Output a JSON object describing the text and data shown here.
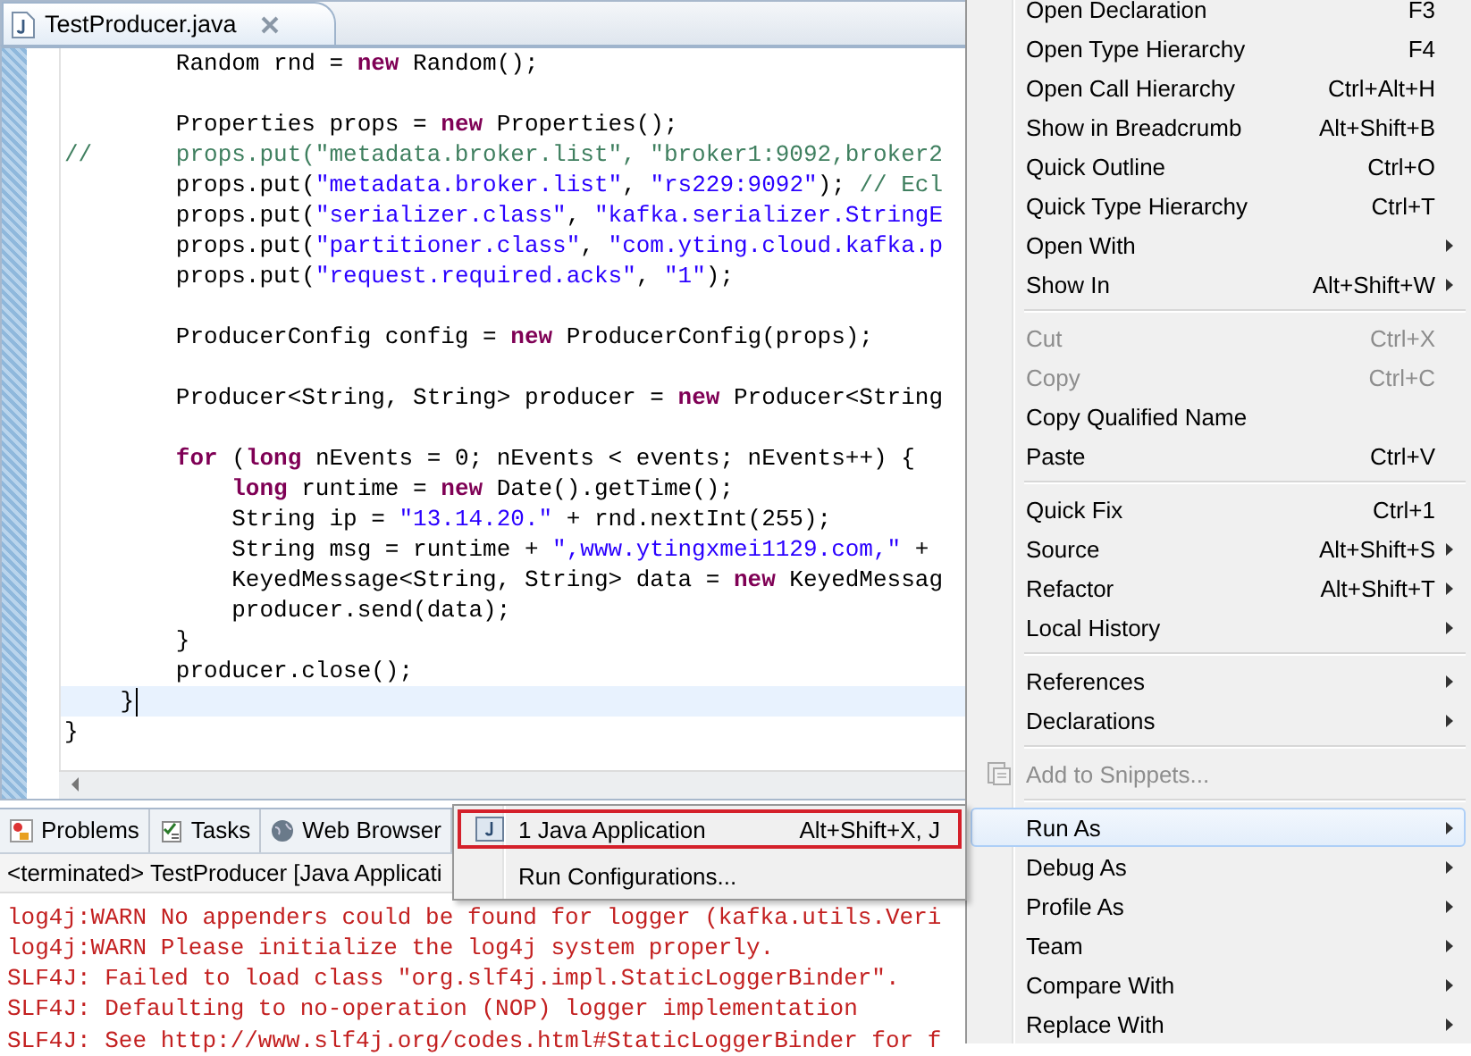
{
  "editor": {
    "tab": {
      "title": "TestProducer.java",
      "selected": true
    },
    "lines": [
      {
        "current": false,
        "tokens": [
          {
            "kind": "plain",
            "text": "        Random rnd = "
          },
          {
            "kind": "keyword",
            "text": "new"
          },
          {
            "kind": "plain",
            "text": " Random();"
          }
        ]
      },
      {
        "current": false
      },
      {
        "current": false,
        "tokens": [
          {
            "kind": "plain",
            "text": "        Properties props = "
          },
          {
            "kind": "keyword",
            "text": "new"
          },
          {
            "kind": "plain",
            "text": " Properties();"
          }
        ]
      },
      {
        "current": false,
        "tokens": [
          {
            "kind": "comment",
            "text": "//      props.put(\"metadata.broker.list\", \"broker1:9092,broker2"
          }
        ]
      },
      {
        "current": false,
        "tokens": [
          {
            "kind": "plain",
            "text": "        props.put("
          },
          {
            "kind": "string",
            "text": "\"metadata.broker.list\""
          },
          {
            "kind": "plain",
            "text": ", "
          },
          {
            "kind": "string",
            "text": "\"rs229:9092\""
          },
          {
            "kind": "plain",
            "text": "); "
          },
          {
            "kind": "comment",
            "text": "// Ecl"
          }
        ]
      },
      {
        "current": false,
        "tokens": [
          {
            "kind": "plain",
            "text": "        props.put("
          },
          {
            "kind": "string",
            "text": "\"serializer.class\""
          },
          {
            "kind": "plain",
            "text": ", "
          },
          {
            "kind": "string",
            "text": "\"kafka.serializer.StringE"
          }
        ]
      },
      {
        "current": false,
        "tokens": [
          {
            "kind": "plain",
            "text": "        props.put("
          },
          {
            "kind": "string",
            "text": "\"partitioner.class\""
          },
          {
            "kind": "plain",
            "text": ", "
          },
          {
            "kind": "string",
            "text": "\"com.yting.cloud.kafka.p"
          }
        ]
      },
      {
        "current": false,
        "tokens": [
          {
            "kind": "plain",
            "text": "        props.put("
          },
          {
            "kind": "string",
            "text": "\"request.required.acks\""
          },
          {
            "kind": "plain",
            "text": ", "
          },
          {
            "kind": "string",
            "text": "\"1\""
          },
          {
            "kind": "plain",
            "text": ");"
          }
        ]
      },
      {
        "current": false
      },
      {
        "current": false,
        "tokens": [
          {
            "kind": "plain",
            "text": "        ProducerConfig config = "
          },
          {
            "kind": "keyword",
            "text": "new"
          },
          {
            "kind": "plain",
            "text": " ProducerConfig(props);"
          }
        ]
      },
      {
        "current": false
      },
      {
        "current": false,
        "tokens": [
          {
            "kind": "plain",
            "text": "        Producer<String, String> producer = "
          },
          {
            "kind": "keyword",
            "text": "new"
          },
          {
            "kind": "plain",
            "text": " Producer<String"
          }
        ]
      },
      {
        "current": false
      },
      {
        "current": false,
        "tokens": [
          {
            "kind": "keyword",
            "text": "        for"
          },
          {
            "kind": "plain",
            "text": " ("
          },
          {
            "kind": "keyword",
            "text": "long"
          },
          {
            "kind": "plain",
            "text": " nEvents = 0; nEvents < events; nEvents++) {"
          }
        ]
      },
      {
        "current": false,
        "tokens": [
          {
            "kind": "keyword",
            "text": "            long"
          },
          {
            "kind": "plain",
            "text": " runtime = "
          },
          {
            "kind": "keyword",
            "text": "new"
          },
          {
            "kind": "plain",
            "text": " Date().getTime();"
          }
        ]
      },
      {
        "current": false,
        "tokens": [
          {
            "kind": "plain",
            "text": "            String ip = "
          },
          {
            "kind": "string",
            "text": "\"13.14.20.\""
          },
          {
            "kind": "plain",
            "text": " + rnd.nextInt(255);"
          }
        ]
      },
      {
        "current": false,
        "tokens": [
          {
            "kind": "plain",
            "text": "            String msg = runtime + "
          },
          {
            "kind": "string",
            "text": "\",www.ytingxmei1129.com,\""
          },
          {
            "kind": "plain",
            "text": " +"
          }
        ]
      },
      {
        "current": false,
        "tokens": [
          {
            "kind": "plain",
            "text": "            KeyedMessage<String, String> data = "
          },
          {
            "kind": "keyword",
            "text": "new"
          },
          {
            "kind": "plain",
            "text": " KeyedMessag"
          }
        ]
      },
      {
        "current": false,
        "tokens": [
          {
            "kind": "plain",
            "text": "            producer.send(data);"
          }
        ]
      },
      {
        "current": false,
        "tokens": [
          {
            "kind": "plain",
            "text": "        }"
          }
        ]
      },
      {
        "current": false,
        "tokens": [
          {
            "kind": "plain",
            "text": "        producer.close();"
          }
        ]
      },
      {
        "current": true,
        "tokens": [
          {
            "kind": "plain",
            "text": "    }"
          }
        ]
      },
      {
        "current": false,
        "tokens": [
          {
            "kind": "plain",
            "text": "}"
          }
        ]
      }
    ]
  },
  "panel": {
    "tabs": [
      {
        "label": "Problems",
        "kind": "problems",
        "selected": false
      },
      {
        "label": "Tasks",
        "kind": "tasks",
        "selected": false
      },
      {
        "label": "Web Browser",
        "kind": "browser",
        "selected": false
      }
    ],
    "console_header": "<terminated> TestProducer [Java Applicati",
    "console_lines": [
      "log4j:WARN No appenders could be found for logger (kafka.utils.Veri",
      "log4j:WARN Please initialize the log4j system properly.",
      "SLF4J: Failed to load class \"org.slf4j.impl.StaticLoggerBinder\".",
      "SLF4J: Defaulting to no-operation (NOP) logger implementation",
      "SLF4J: See http://www.slf4j.org/codes.html#StaticLoggerBinder for f"
    ]
  },
  "context_menu": {
    "sections": [
      {
        "items": [
          {
            "label": "Open Declaration",
            "shortcut": "F3",
            "submenu": false,
            "disabled": false,
            "selected": false,
            "kind": "plain"
          },
          {
            "label": "Open Type Hierarchy",
            "shortcut": "F4",
            "submenu": false,
            "disabled": false,
            "selected": false,
            "kind": "plain"
          },
          {
            "label": "Open Call Hierarchy",
            "shortcut": "Ctrl+Alt+H",
            "submenu": false,
            "disabled": false,
            "selected": false,
            "kind": "plain"
          },
          {
            "label": "Show in Breadcrumb",
            "shortcut": "Alt+Shift+B",
            "submenu": false,
            "disabled": false,
            "selected": false,
            "kind": "plain"
          },
          {
            "label": "Quick Outline",
            "shortcut": "Ctrl+O",
            "submenu": false,
            "disabled": false,
            "selected": false,
            "kind": "plain"
          },
          {
            "label": "Quick Type Hierarchy",
            "shortcut": "Ctrl+T",
            "submenu": false,
            "disabled": false,
            "selected": false,
            "kind": "plain"
          },
          {
            "label": "Open With",
            "submenu": true,
            "disabled": false,
            "selected": false,
            "kind": "plain"
          },
          {
            "label": "Show In",
            "shortcut": "Alt+Shift+W",
            "submenu": true,
            "disabled": false,
            "selected": false,
            "kind": "plain"
          }
        ]
      },
      {
        "items": [
          {
            "label": "Cut",
            "shortcut": "Ctrl+X",
            "submenu": false,
            "disabled": true,
            "selected": false,
            "kind": "plain"
          },
          {
            "label": "Copy",
            "shortcut": "Ctrl+C",
            "submenu": false,
            "disabled": true,
            "selected": false,
            "kind": "plain"
          },
          {
            "label": "Copy Qualified Name",
            "submenu": false,
            "disabled": false,
            "selected": false,
            "kind": "plain"
          },
          {
            "label": "Paste",
            "shortcut": "Ctrl+V",
            "submenu": false,
            "disabled": false,
            "selected": false,
            "kind": "plain"
          }
        ]
      },
      {
        "items": [
          {
            "label": "Quick Fix",
            "shortcut": "Ctrl+1",
            "submenu": false,
            "disabled": false,
            "selected": false,
            "kind": "plain"
          },
          {
            "label": "Source",
            "shortcut": "Alt+Shift+S",
            "submenu": true,
            "disabled": false,
            "selected": false,
            "kind": "plain"
          },
          {
            "label": "Refactor",
            "shortcut": "Alt+Shift+T",
            "submenu": true,
            "disabled": false,
            "selected": false,
            "kind": "plain"
          },
          {
            "label": "Local History",
            "submenu": true,
            "disabled": false,
            "selected": false,
            "kind": "plain"
          }
        ]
      },
      {
        "items": [
          {
            "label": "References",
            "submenu": true,
            "disabled": false,
            "selected": false,
            "kind": "plain"
          },
          {
            "label": "Declarations",
            "submenu": true,
            "disabled": false,
            "selected": false,
            "kind": "plain"
          }
        ]
      },
      {
        "items": [
          {
            "label": "Add to Snippets...",
            "submenu": false,
            "disabled": true,
            "selected": false,
            "kind": "snippet"
          }
        ]
      },
      {
        "items": [
          {
            "label": "Run As",
            "submenu": true,
            "disabled": false,
            "selected": true,
            "kind": "plain"
          },
          {
            "label": "Debug As",
            "submenu": true,
            "disabled": false,
            "selected": false,
            "kind": "plain"
          },
          {
            "label": "Profile As",
            "submenu": true,
            "disabled": false,
            "selected": false,
            "kind": "plain"
          },
          {
            "label": "Team",
            "submenu": true,
            "disabled": false,
            "selected": false,
            "kind": "plain"
          },
          {
            "label": "Compare With",
            "submenu": true,
            "disabled": false,
            "selected": false,
            "kind": "plain"
          },
          {
            "label": "Replace With",
            "submenu": true,
            "disabled": false,
            "selected": false,
            "kind": "plain"
          }
        ]
      }
    ]
  },
  "submenu": {
    "items": [
      {
        "label": "1 Java Application",
        "shortcut": "Alt+Shift+X, J",
        "selected": true,
        "kind": "java"
      },
      {
        "label": "Run Configurations...",
        "selected": false,
        "kind": "plain"
      }
    ]
  }
}
